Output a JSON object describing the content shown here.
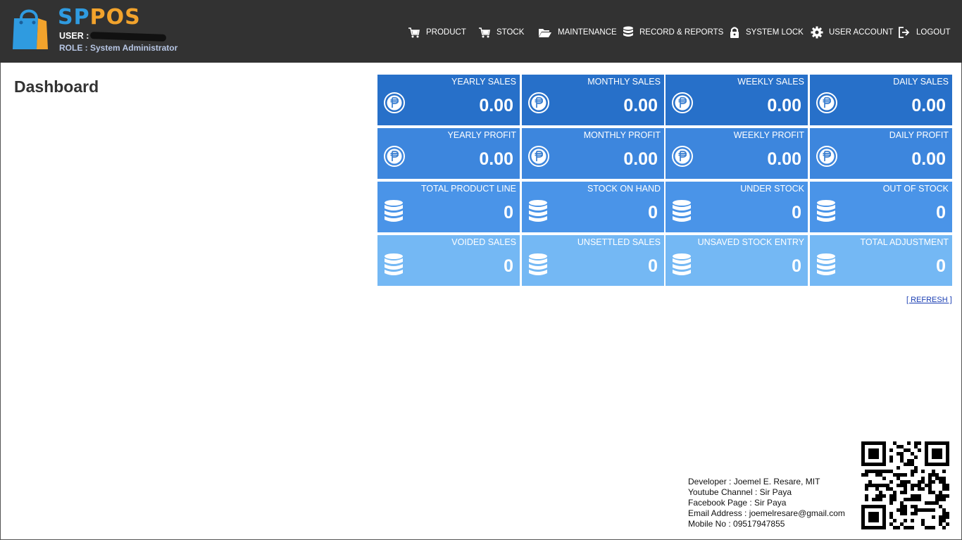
{
  "app": {
    "brand_part1": "SP",
    "brand_part2": "POS",
    "user_label": "USER :",
    "role_text": "ROLE : System Administrator"
  },
  "nav": [
    {
      "label": "PRODUCT",
      "icon": "cart-icon"
    },
    {
      "label": "STOCK",
      "icon": "cart-icon"
    },
    {
      "label": "MAINTENANCE",
      "icon": "folder-open-icon"
    },
    {
      "label": "RECORD & REPORTS",
      "icon": "database-icon"
    },
    {
      "label": "SYSTEM LOCK",
      "icon": "lock-icon"
    },
    {
      "label": "USER ACCOUNT",
      "icon": "gear-icon"
    },
    {
      "label": "LOGOUT",
      "icon": "logout-icon"
    }
  ],
  "page_title": "Dashboard",
  "tiles": [
    {
      "label": "YEARLY SALES",
      "value": "0.00",
      "icon": "peso-icon"
    },
    {
      "label": "MONTHLY SALES",
      "value": "0.00",
      "icon": "peso-icon"
    },
    {
      "label": "WEEKLY SALES",
      "value": "0.00",
      "icon": "peso-icon"
    },
    {
      "label": "DAILY SALES",
      "value": "0.00",
      "icon": "peso-icon"
    },
    {
      "label": "YEARLY PROFIT",
      "value": "0.00",
      "icon": "peso-icon"
    },
    {
      "label": "MONTHLY PROFIT",
      "value": "0.00",
      "icon": "peso-icon"
    },
    {
      "label": "WEEKLY PROFIT",
      "value": "0.00",
      "icon": "peso-icon"
    },
    {
      "label": "DAILY PROFIT",
      "value": "0.00",
      "icon": "peso-icon"
    },
    {
      "label": "TOTAL PRODUCT LINE",
      "value": "0",
      "icon": "database-icon"
    },
    {
      "label": "STOCK ON HAND",
      "value": "0",
      "icon": "database-icon"
    },
    {
      "label": "UNDER STOCK",
      "value": "0",
      "icon": "database-icon"
    },
    {
      "label": "OUT OF STOCK",
      "value": "0",
      "icon": "database-icon"
    },
    {
      "label": "VOIDED SALES",
      "value": "0",
      "icon": "database-icon"
    },
    {
      "label": "UNSETTLED SALES",
      "value": "0",
      "icon": "database-icon"
    },
    {
      "label": "UNSAVED STOCK ENTRY",
      "value": "0",
      "icon": "database-icon"
    },
    {
      "label": "TOTAL ADJUSTMENT",
      "value": "0",
      "icon": "database-icon"
    }
  ],
  "refresh_label": "[ REFRESH ]",
  "developer": {
    "line1": "Developer : Joemel E. Resare, MIT",
    "line2": "Youtube Channel : Sir Paya",
    "line3": "Facebook Page : Sir Paya",
    "line4": "Email Address :  joemelresare@gmail.com",
    "line5": "Mobile No : 09517947855"
  },
  "colors": {
    "header_bg": "#323232",
    "brand_blue": "#2f9be0",
    "brand_orange": "#f2a32c",
    "tile_row1": "#2770c9",
    "tile_row2": "#3d86dd",
    "tile_row3": "#4a94e8",
    "tile_row4": "#74b8f4"
  }
}
